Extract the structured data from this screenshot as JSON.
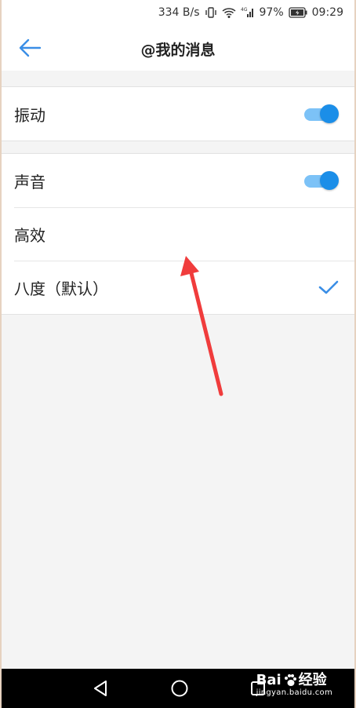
{
  "status_bar": {
    "network_speed": "334 B/s",
    "battery_percent": "97%",
    "time": "09:29",
    "icons": [
      "vibrate-icon",
      "wifi-icon",
      "signal-icon",
      "battery-icon"
    ]
  },
  "header": {
    "title": "@我的消息",
    "back_icon": "back-arrow-icon",
    "accent_color": "#3a8ee6"
  },
  "group_vibrate": {
    "rows": [
      {
        "label": "振动",
        "toggle_on": true
      }
    ]
  },
  "group_sound": {
    "rows": [
      {
        "label": "声音",
        "toggle_on": true
      },
      {
        "label": "高效",
        "selected": false
      },
      {
        "label": "八度（默认）",
        "selected": true
      }
    ]
  },
  "nav_bar": {
    "buttons": [
      "back-triangle-icon",
      "home-circle-icon",
      "recents-square-icon"
    ]
  },
  "watermark": {
    "brand": "Bai",
    "brand_suffix": "经验",
    "url": "jingyan.baidu.com"
  },
  "colors": {
    "toggle_knob": "#1b8ee8",
    "toggle_track": "#7cc2f7",
    "checkmark": "#3a8ee6",
    "annotation_arrow": "#f03c3c"
  }
}
